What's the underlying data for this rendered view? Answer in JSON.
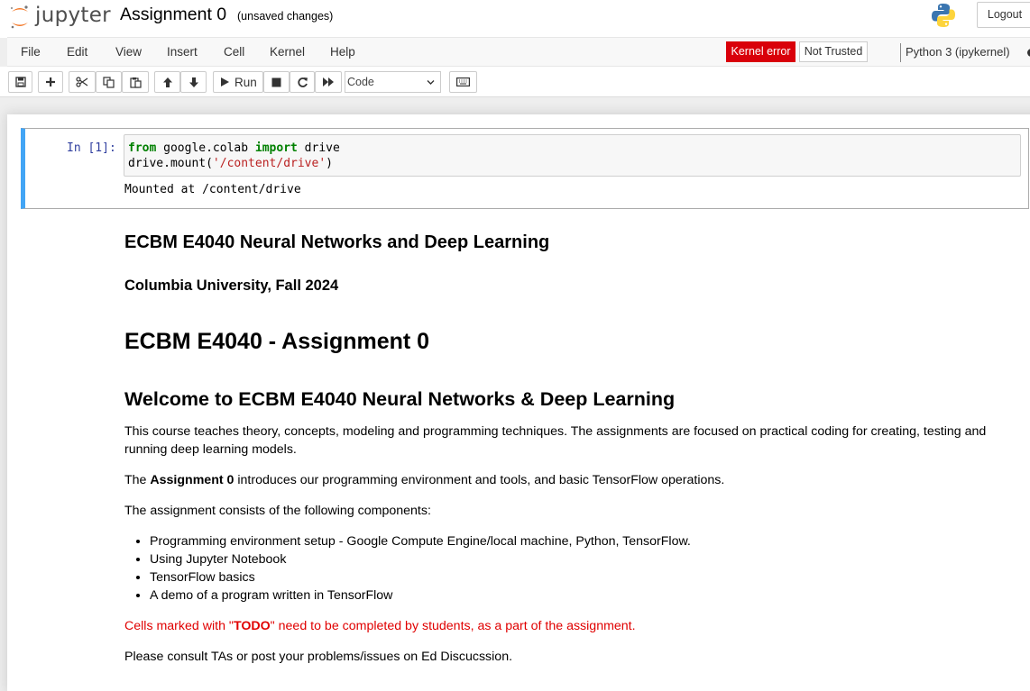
{
  "header": {
    "logo_text": "jupyter",
    "notebook_title": "Assignment 0",
    "save_status": "(unsaved changes)",
    "logout_label": "Logout"
  },
  "menubar": {
    "items": [
      "File",
      "Edit",
      "View",
      "Insert",
      "Cell",
      "Kernel",
      "Help"
    ],
    "kernel_error": "Kernel error",
    "not_trusted": "Not Trusted",
    "kernel_name": "Python 3 (ipykernel)"
  },
  "toolbar": {
    "run_label": "Run",
    "cell_type": "Code"
  },
  "code_cell": {
    "prompt": "In [1]:",
    "code_line1": {
      "kw1": "from",
      "mod": " google.colab ",
      "kw2": "import",
      "rest": " drive"
    },
    "code_line2": {
      "pre": "drive.mount(",
      "str": "'/content/drive'",
      "post": ")"
    },
    "output": "Mounted at /content/drive"
  },
  "markdown": {
    "course_title": "ECBM E4040 Neural Networks and Deep Learning",
    "university": "Columbia University, Fall 2024",
    "assignment_title": "ECBM E4040 - Assignment 0",
    "welcome": "Welcome to ECBM E4040 Neural Networks & Deep Learning",
    "intro": "This course teaches theory, concepts, modeling and programming techniques. The assignments are focused on practical coding for creating, testing and running deep learning models.",
    "assignment_intro": {
      "pre": "The ",
      "bold": "Assignment 0",
      "post": " introduces our programming environment and tools, and basic TensorFlow operations."
    },
    "components_intro": "The assignment consists of the following components:",
    "components": [
      "Programming environment setup - Google Compute Engine/local machine, Python, TensorFlow.",
      "Using Jupyter Notebook",
      "TensorFlow basics",
      "A demo of a program written in TensorFlow"
    ],
    "todo_note": {
      "pre": "Cells marked with \"",
      "bold": "TODO",
      "post": "\" need to be completed by students, as a part of the assignment."
    },
    "consult": "Please consult TAs or post your problems/issues on Ed Discucssion."
  },
  "colors": {
    "accent_blue": "#42a5f5",
    "kernel_error_bg": "#d9000a",
    "todo_red": "#e00000",
    "jupyter_orange": "#f37726"
  },
  "icons": [
    "jupyter-logo-icon",
    "python-logo-icon",
    "save-icon",
    "plus-icon",
    "cut-icon",
    "copy-icon",
    "paste-icon",
    "arrow-up-icon",
    "arrow-down-icon",
    "play-icon",
    "stop-icon",
    "restart-icon",
    "fast-forward-icon",
    "keyboard-icon",
    "chevron-down-icon",
    "kernel-busy-icon"
  ]
}
